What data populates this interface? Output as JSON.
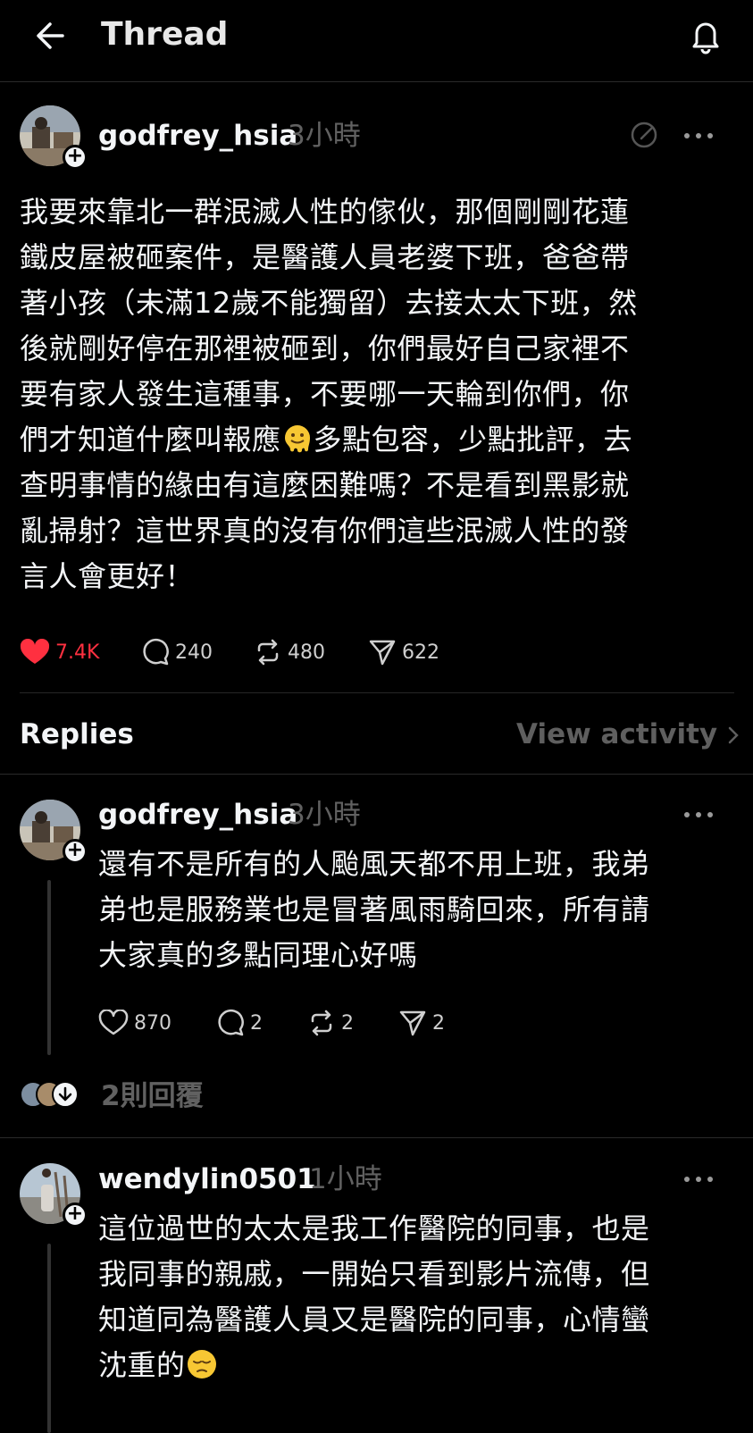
{
  "header": {
    "title": "Thread"
  },
  "post": {
    "username": "godfrey_hsia",
    "time": "3小時",
    "lines": [
      "我要來靠北一群泯滅人性的傢伙，那個剛剛花蓮",
      "鐵皮屋被砸案件，是醫護人員老婆下班，爸爸帶",
      "著小孩（未滿12歲不能獨留）去接太太下班，然",
      "後就剛好停在那裡被砸到，你們最好自己家裡不",
      "要有家人發生這種事，不要哪一天輪到你們，你",
      "們才知道什麼叫報應",
      "多點包容，少點批評，去",
      "查明事情的緣由有這麼困難嗎？不是看到黑影就",
      "亂掃射？這世界真的沒有你們這些泯滅人性的發",
      "言人會更好！"
    ],
    "likes": "7.4K",
    "comments": "240",
    "reposts": "480",
    "shares": "622"
  },
  "replies_bar": {
    "label": "Replies",
    "view_activity": "View activity"
  },
  "reply1": {
    "username": "godfrey_hsia",
    "time": "3小時",
    "lines": [
      "還有不是所有的人颱風天都不用上班，我弟",
      "弟也是服務業也是冒著風雨騎回來，所有請",
      "大家真的多點同理心好嗎"
    ],
    "likes": "870",
    "comments": "2",
    "reposts": "2",
    "shares": "2",
    "more_replies": "2則回覆"
  },
  "reply2": {
    "username": "wendylin0501",
    "time": "1小時",
    "lines": [
      "這位過世的太太是我工作醫院的同事，也是",
      "我同事的親戚，一開始只看到影片流傳，但",
      "知道同為醫護人員又是醫院的同事，心情蠻",
      "沈重的"
    ]
  },
  "colors": {
    "background": "#000000",
    "text": "#f3f5f7",
    "muted": "#616161",
    "like_red": "#ff3040"
  },
  "icons": [
    "back-arrow-icon",
    "bell-icon",
    "edit-icon",
    "more-icon",
    "heart-icon",
    "comment-icon",
    "repost-icon",
    "share-icon",
    "melting-face-emoji",
    "pensive-face-emoji"
  ]
}
